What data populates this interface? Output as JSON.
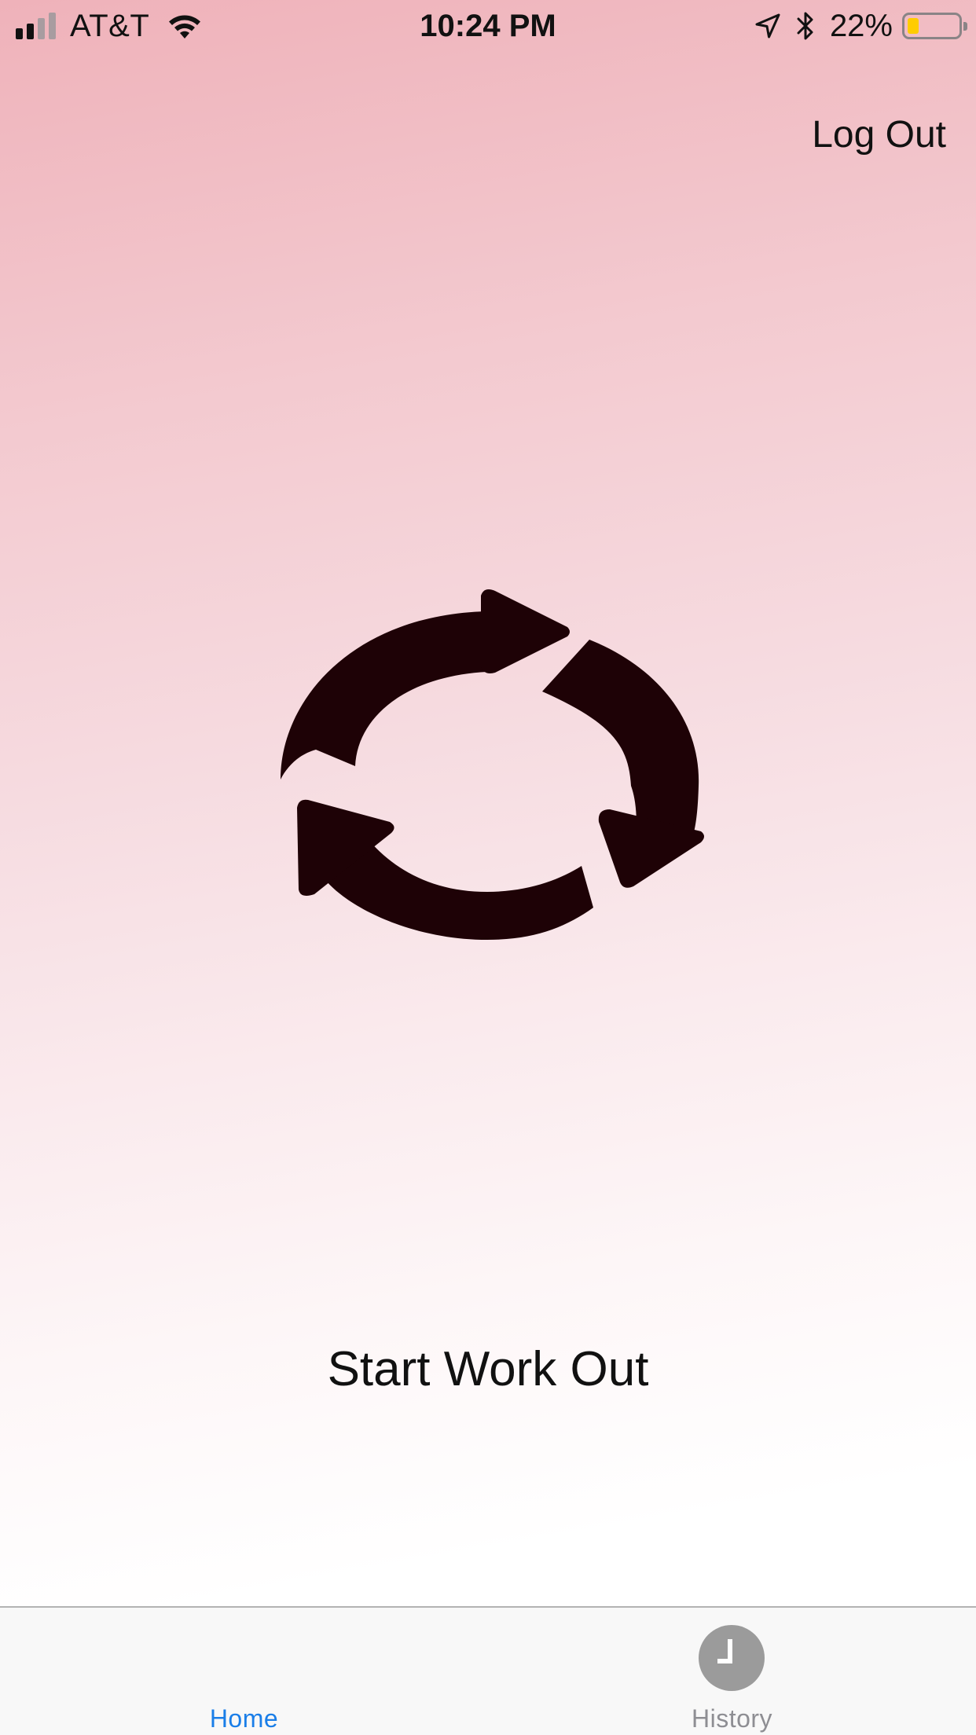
{
  "status_bar": {
    "carrier": "AT&T",
    "time": "10:24 PM",
    "battery_percent": "22%",
    "battery_level": 0.22,
    "battery_color": "#ffcc00",
    "signal_bars_filled": 2,
    "signal_bars_total": 4,
    "icons": [
      "signal-icon",
      "wifi-icon",
      "location-arrow-icon",
      "bluetooth-icon",
      "battery-icon"
    ]
  },
  "header": {
    "logout_label": "Log Out"
  },
  "main": {
    "center_icon": "cycle-arrows-icon",
    "start_label": "Start Work Out"
  },
  "tab_bar": {
    "tabs": [
      {
        "label": "Home",
        "selected": true,
        "color": "#1a7ee8"
      },
      {
        "label": "History",
        "selected": false,
        "icon": "clock-icon",
        "color": "#8e8e93"
      }
    ]
  },
  "colors": {
    "gradient_top": "#efb2ba",
    "gradient_bottom": "#ffffff",
    "icon_fill": "#1e0206"
  }
}
